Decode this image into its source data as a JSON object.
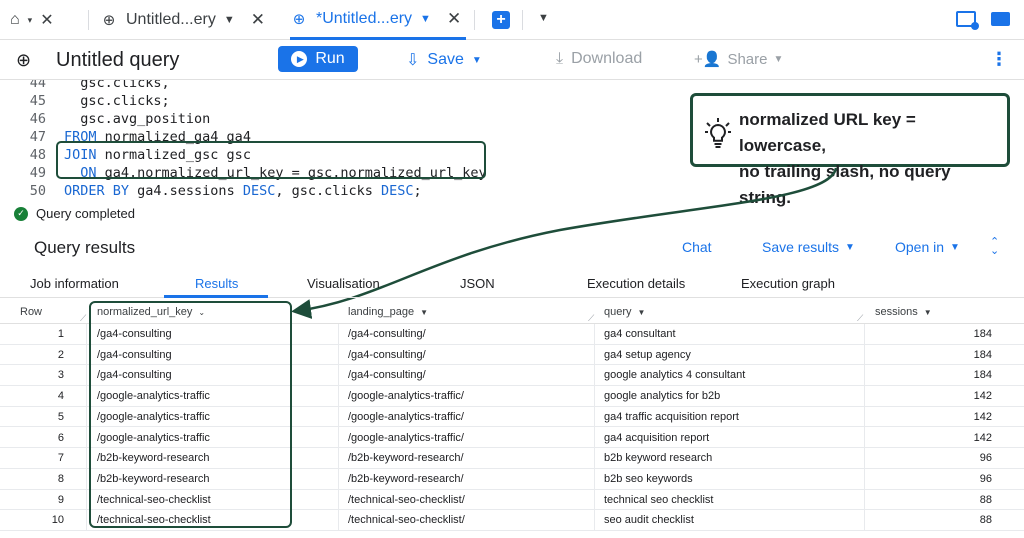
{
  "tabbar": {
    "tab1_label": "Untitled...ery",
    "tab2_label": "*Untitled...ery"
  },
  "header": {
    "title": "Untitled query",
    "run_label": "Run",
    "save_label": "Save",
    "download_label": "Download",
    "share_label": "Share"
  },
  "editor": {
    "lines": [
      {
        "num": "44",
        "code": "  gsc.clicks,"
      },
      {
        "num": "45",
        "code": "  gsc.clicks;"
      },
      {
        "num": "46",
        "code": "  gsc.avg_position"
      },
      {
        "num": "47",
        "kw": "FROM",
        "code": " normalized_ga4 ga4"
      },
      {
        "num": "48",
        "kw": "JOIN",
        "code": " normalized_gsc gsc"
      },
      {
        "num": "49",
        "pre": "  ",
        "kw": "ON",
        "code": " ga4.normalized_url_key = gsc.normalized_url_key"
      },
      {
        "num": "50",
        "kw": "ORDER BY",
        "code": " ga4.sessions DESC, gsc.clicks DESC;"
      }
    ]
  },
  "callout": {
    "line1": "normalized URL key = lowercase,",
    "line2": "no trailing slash, no query string."
  },
  "status": {
    "text": "Query completed"
  },
  "results": {
    "title": "Query results",
    "chat_label": "Chat",
    "save_results_label": "Save results",
    "open_in_label": "Open in",
    "tabs": [
      "Job information",
      "Results",
      "Visualisation",
      "JSON",
      "Execution details",
      "Execution graph"
    ],
    "active_tab": "Results"
  },
  "table": {
    "columns": [
      "Row",
      "normalized_url_key",
      "landing_page",
      "query",
      "sessions"
    ],
    "rows": [
      {
        "row": "1",
        "url": "/ga4-consulting",
        "lp": "/ga4-consulting/",
        "query": "ga4 consultant",
        "sessions": "184"
      },
      {
        "row": "2",
        "url": "/ga4-consulting",
        "lp": "/ga4-consulting/",
        "query": "ga4 setup agency",
        "sessions": "184"
      },
      {
        "row": "3",
        "url": "/ga4-consulting",
        "lp": "/ga4-consulting/",
        "query": "google analytics 4 consultant",
        "sessions": "184"
      },
      {
        "row": "4",
        "url": "/google-analytics-traffic",
        "lp": "/google-analytics-traffic/",
        "query": "google analytics for b2b",
        "sessions": "142"
      },
      {
        "row": "5",
        "url": "/google-analytics-traffic",
        "lp": "/google-analytics-traffic/",
        "query": "ga4 traffic acquisition report",
        "sessions": "142"
      },
      {
        "row": "6",
        "url": "/google-analytics-traffic",
        "lp": "/google-analytics-traffic/",
        "query": "ga4 acquisition report",
        "sessions": "142"
      },
      {
        "row": "7",
        "url": "/b2b-keyword-research",
        "lp": "/b2b-keyword-research/",
        "query": "b2b keyword research",
        "sessions": "96"
      },
      {
        "row": "8",
        "url": "/b2b-keyword-research",
        "lp": "/b2b-keyword-research/",
        "query": "b2b seo keywords",
        "sessions": "96"
      },
      {
        "row": "9",
        "url": "/technical-seo-checklist",
        "lp": "/technical-seo-checklist/",
        "query": "technical seo checklist",
        "sessions": "88"
      },
      {
        "row": "10",
        "url": "/technical-seo-checklist",
        "lp": "/technical-seo-checklist/",
        "query": "seo audit checklist",
        "sessions": "88"
      }
    ]
  },
  "colors": {
    "accent": "#1a73e8",
    "highlight_border": "#1e4d3a",
    "success": "#188038"
  },
  "icons": [
    "home-icon",
    "query-icon",
    "close-icon",
    "plus-icon",
    "play-icon",
    "save-icon",
    "download-icon",
    "share-icon",
    "kebab-icon",
    "lightbulb-icon",
    "check-icon"
  ]
}
